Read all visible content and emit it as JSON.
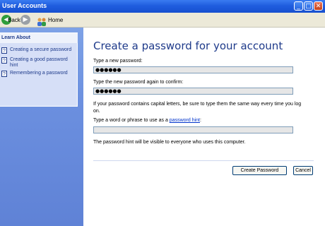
{
  "window": {
    "title": "User Accounts"
  },
  "window_controls": {
    "minimize": "_",
    "maximize": "□",
    "close": "✕"
  },
  "toolbar": {
    "back_label": "Back",
    "home_label": "Home"
  },
  "sidebar": {
    "learn_title": "Learn About",
    "items": [
      {
        "label": "Creating a secure password",
        "icon": "help-icon"
      },
      {
        "label": "Creating a good password hint",
        "icon": "help-icon"
      },
      {
        "label": "Remembering a password",
        "icon": "help-icon"
      }
    ]
  },
  "main": {
    "heading": "Create a password for your account",
    "new_password_label": "Type a new password:",
    "new_password_value": "●●●●●●",
    "confirm_label": "Type the new password again to confirm:",
    "confirm_value": "●●●●●●",
    "caps_note": "If your password contains capital letters, be sure to type them the same way every time you log on.",
    "hint_label_prefix": "Type a word or phrase to use as a ",
    "hint_link": "password hint",
    "hint_label_suffix": ":",
    "hint_value": "",
    "hint_note": "The password hint will be visible to everyone who uses this computer.",
    "create_button": "Create Password",
    "cancel_button": "Cancel"
  },
  "colors": {
    "titlebar": "#1f5ddf",
    "sidebar": "#6b8fdf",
    "heading": "#1e3a8a",
    "link": "#0033cc"
  }
}
